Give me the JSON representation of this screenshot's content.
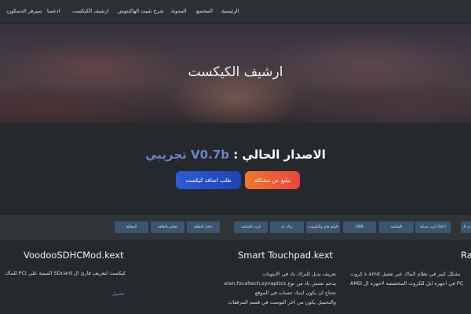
{
  "nav": {
    "items": [
      {
        "label": "الرئيسية"
      },
      {
        "label": "المجتمع"
      },
      {
        "label": "المدونة"
      },
      {
        "label": "شرح تثبيت الهاكنتوش"
      },
      {
        "label": "ارشيف الكيكست"
      },
      {
        "label": "ادعمنا"
      },
      {
        "label": "سيرفر الدسكورد"
      }
    ]
  },
  "hero": {
    "title": "ارشيف الكيكست"
  },
  "version": {
    "label": "الاصدار الحالي :",
    "value": "V0.7b تجريبي"
  },
  "buttons": {
    "report": "تبليغ عن مشكلة",
    "request": "طلب اضافة كيكست"
  },
  "filters": {
    "chips": [
      {
        "label": "كرت الـ..."
      },
      {
        "label": "كرت شبكة (lan)"
      },
      {
        "label": "الشاشة"
      },
      {
        "label": "USB"
      },
      {
        "label": "الواي فاي والبلوتوث"
      },
      {
        "label": "تراك باد"
      },
      {
        "label": "كرت الشاشة"
      },
      {
        "label": "داخل النظام"
      },
      {
        "label": "تحكم بالطاقة"
      },
      {
        "label": "المعالج"
      }
    ]
  },
  "cards": {
    "left": {
      "title": "VoodooSDHCMod.kext",
      "line1": "كيكست لتعريف قارئ ال SDcard المبنية على PCI للماك",
      "link": "تحميل"
    },
    "middle": {
      "title": "Smart Touchpad.kext",
      "line1": "تعريف بديل للتراك باد في الابتوبات",
      "line2": "يدعم تشش باد من نوع elan,focaltech,synaptics",
      "line3": "تحتاج ان يكون لديك حساب في الموقع",
      "line4": "والتحميل يكون من اخر البوست في قسم المرفقات"
    },
    "right": {
      "title": "Ra",
      "line1": "ة كروت amd بشكل كبير في نظام الماك عبر تفعيل",
      "line2": "AMD في اجهزه ابل للكروت المخصصه لاجهزه ال PC"
    }
  }
}
